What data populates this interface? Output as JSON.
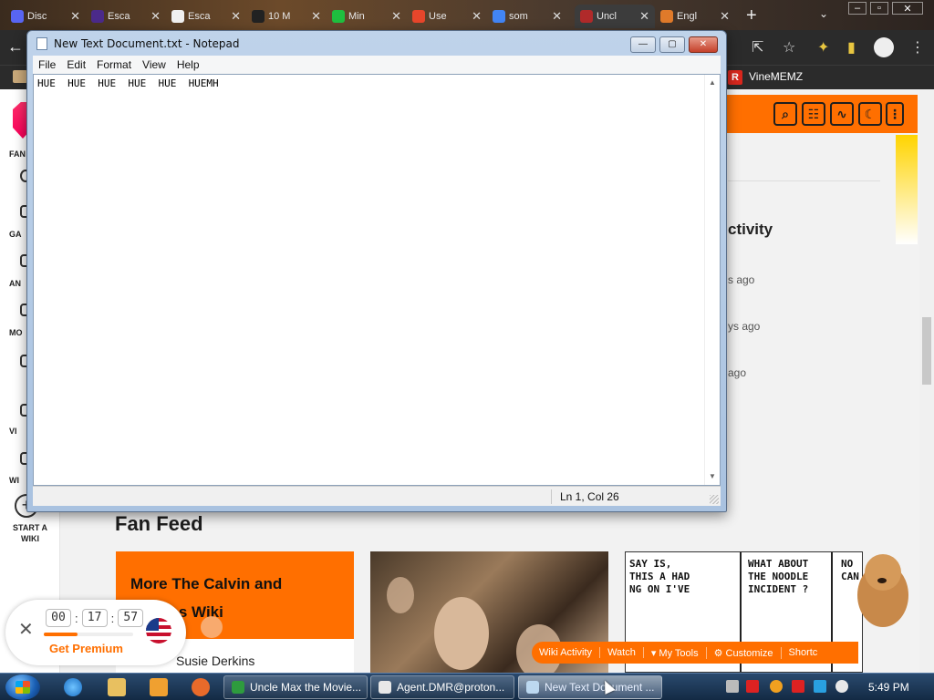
{
  "browser": {
    "tabs": [
      {
        "label": "Disc",
        "favicon_color": "#5865f2"
      },
      {
        "label": "Esca",
        "favicon_color": "#4b2a8a"
      },
      {
        "label": "Esca",
        "favicon_color": "#f0f0f0"
      },
      {
        "label": "10 M",
        "favicon_color": "#222222"
      },
      {
        "label": "Min",
        "favicon_color": "#1fbf3f"
      },
      {
        "label": "Use",
        "favicon_color": "#e8462b"
      },
      {
        "label": "som",
        "favicon_color": "#4285f4"
      },
      {
        "label": "Uncl",
        "favicon_color": "#b02a2a",
        "active": true
      },
      {
        "label": "Engl",
        "favicon_color": "#e07a2a"
      }
    ],
    "new_tab_label": "+",
    "bookmark": {
      "icon_text": "R",
      "label": "VineMEMZ"
    }
  },
  "notepad": {
    "title": "New Text Document.txt - Notepad",
    "menu": [
      "File",
      "Edit",
      "Format",
      "View",
      "Help"
    ],
    "content": "HUE  HUE  HUE  HUE  HUE  HUEMH",
    "status_position": "Ln 1, Col 26",
    "buttons": {
      "minimize": "—",
      "maximize": "▢",
      "close": "✕"
    }
  },
  "fandom": {
    "leftnav": [
      "FAN",
      "GA",
      "AN",
      "MO",
      "VI",
      "WI"
    ],
    "start_wiki": "START A WIKI",
    "activity_title": "ctivity",
    "activity_times": [
      "s ago",
      "ys ago",
      "ago"
    ],
    "fan_feed_title": "Fan Feed",
    "card_title": "More The Calvin and Hobbes Wiki",
    "card_author": "Susie Derkins",
    "comic_panels": [
      "SAY IS, THIS A HAD NG ON I'VE",
      "WHAT ABOUT THE NOODLE INCIDENT ?",
      "NO CAN"
    ],
    "wiki_toolbar": [
      "Wiki Activity",
      "Watch",
      "My Tools",
      "Customize",
      "Shortc"
    ],
    "premium": {
      "timer": [
        "00",
        "17",
        "57"
      ],
      "label": "Get Premium",
      "progress": 0.38
    }
  },
  "taskbar": {
    "tasks": [
      {
        "label": "Uncle Max the Movie...",
        "icon_color": "#2e9b3e"
      },
      {
        "label": "Agent.DMR@proton...",
        "icon_color": "#e8e8e8"
      },
      {
        "label": "New Text Document ...",
        "icon_color": "#bcd8f0",
        "active": true
      }
    ],
    "clock": "5:49 PM"
  }
}
